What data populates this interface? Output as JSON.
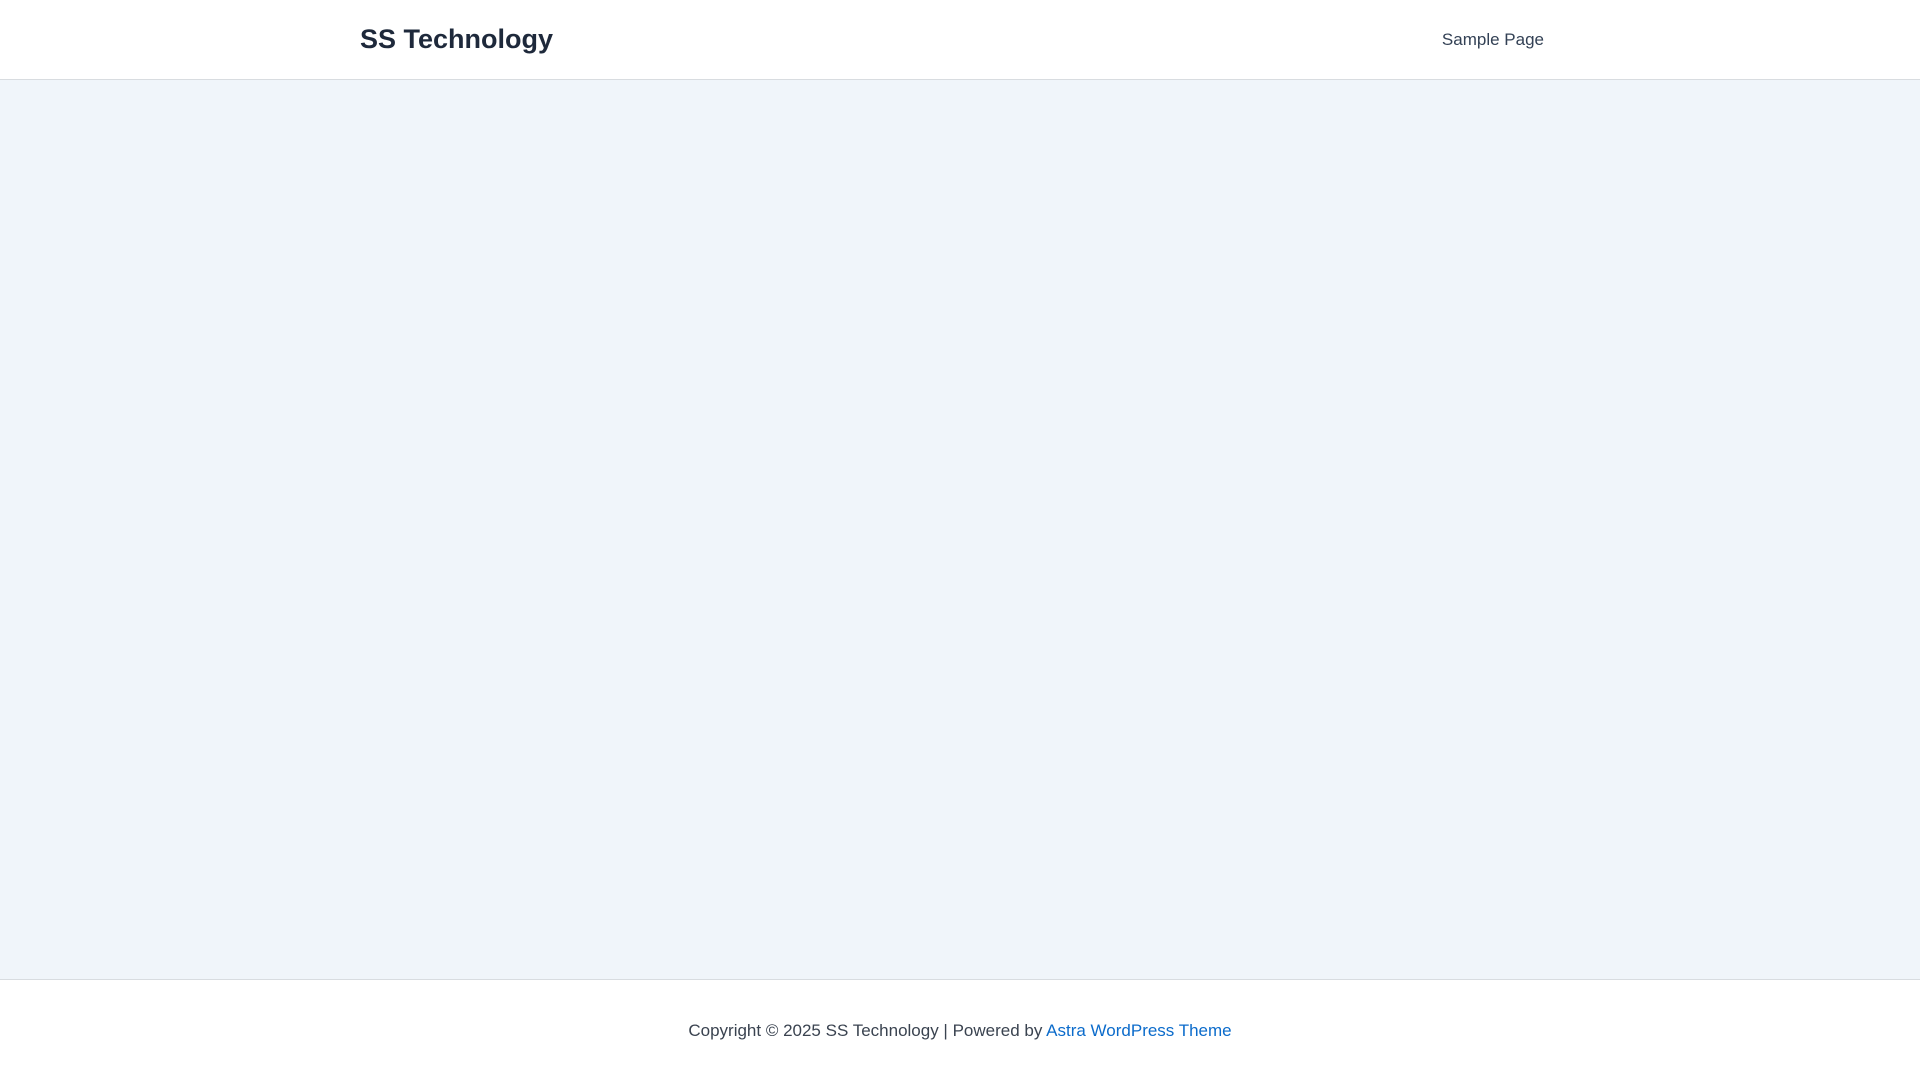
{
  "header": {
    "site_title": "SS Technology",
    "nav": [
      {
        "label": "Sample Page"
      }
    ]
  },
  "footer": {
    "copyright_text": "Copyright © 2025 SS Technology | Powered by ",
    "theme_link": "Astra WordPress Theme"
  },
  "colors": {
    "header_bg": "#ffffff",
    "content_bg": "#f0f5fa",
    "title_color": "#1e293b",
    "link_color": "#0b6bcb"
  }
}
